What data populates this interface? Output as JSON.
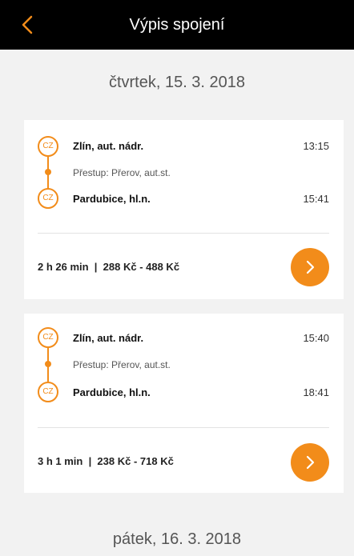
{
  "header": {
    "title": "Výpis spojení",
    "back_icon": "chevron-left-icon",
    "background": "#000000",
    "accent": "#f28c1a"
  },
  "days": [
    {
      "label": "čtvrtek, 15. 3. 2018",
      "connections": [
        {
          "from_badge": "CZ",
          "from": "Zlín, aut. nádr.",
          "depart": "13:15",
          "transfer": "Přestup: Přerov, aut.st.",
          "to_badge": "CZ",
          "to": "Pardubice, hl.n.",
          "arrive": "15:41",
          "summary": "2 h 26 min  |  288 Kč - 488 Kč"
        },
        {
          "from_badge": "CZ",
          "from": "Zlín, aut. nádr.",
          "depart": "15:40",
          "transfer": "Přestup: Přerov, aut.st.",
          "to_badge": "CZ",
          "to": "Pardubice, hl.n.",
          "arrive": "18:41",
          "summary": "3 h 1 min  |  238 Kč - 718 Kč"
        }
      ]
    },
    {
      "label": "pátek, 16. 3. 2018",
      "connections": []
    }
  ]
}
